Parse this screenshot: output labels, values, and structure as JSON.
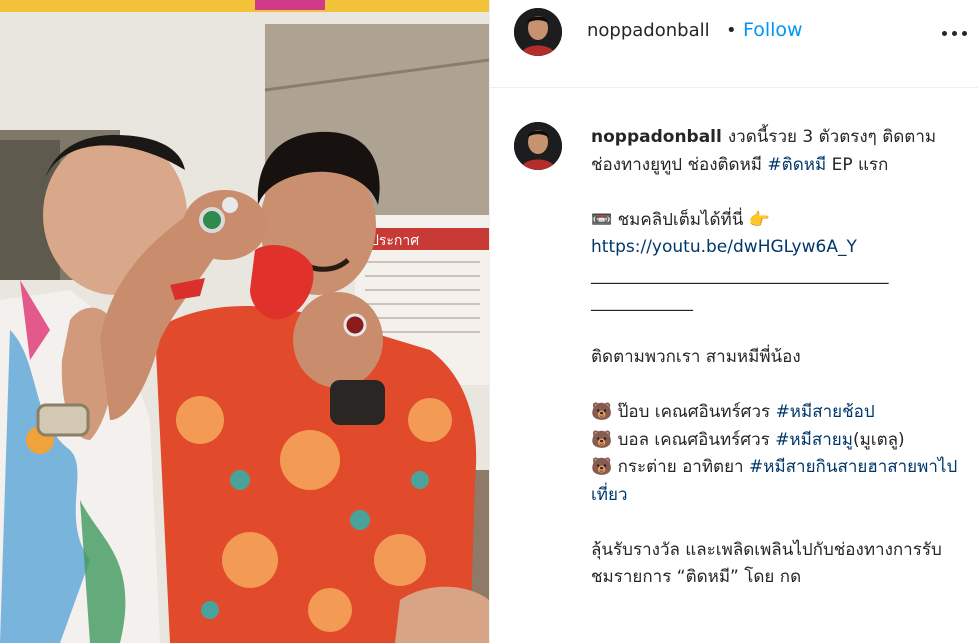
{
  "post": {
    "username": "noppadonball",
    "separator": "•",
    "follow_label": "Follow",
    "more_label": "more options"
  },
  "caption": {
    "username": "noppadonball",
    "line1_text": "งวดนี้รวย 3 ตัวตรงๆ ติดตามช่องทางยูทูป ช่องติดหมี ",
    "line1_tag": "#ติดหมี",
    "line1_tail": " EP แรก",
    "clip_emoji": "📼",
    "clip_text": " ชมคลิปเต็มได้ที่นี่ ",
    "point_emoji": "👉",
    "link": "https://youtu.be/dwHGLyw6A_Y",
    "rule1": "___________________________________",
    "rule2": "____________",
    "follow_text": "ติดตามพวกเรา สามหมีพี่น้อง",
    "bear_emoji": "🐻",
    "m1_text": " ป๊อบ เคณศอินทร์ศวร ",
    "m1_tag": "#หมีสายช้อป",
    "m2_text": " บอล เคณศอินทร์ศวร ",
    "m2_tag": "#หมีสายมู",
    "m2_tail": "(มูเตลู)",
    "m3_text": " กระต่าย อาทิตยา ",
    "m3_tag": "#หมีสายกินสายฮาสายพาไปเที่ยว",
    "closing": "ลุ้นรับรางวัล และเพลิดเพลินไปกับช่องทางการรับชมรายการ “ติดหมี” โดย กด"
  },
  "colors": {
    "follow": "#0095f6",
    "hashtag": "#00376b",
    "text": "#262626",
    "divider": "#efefef"
  }
}
